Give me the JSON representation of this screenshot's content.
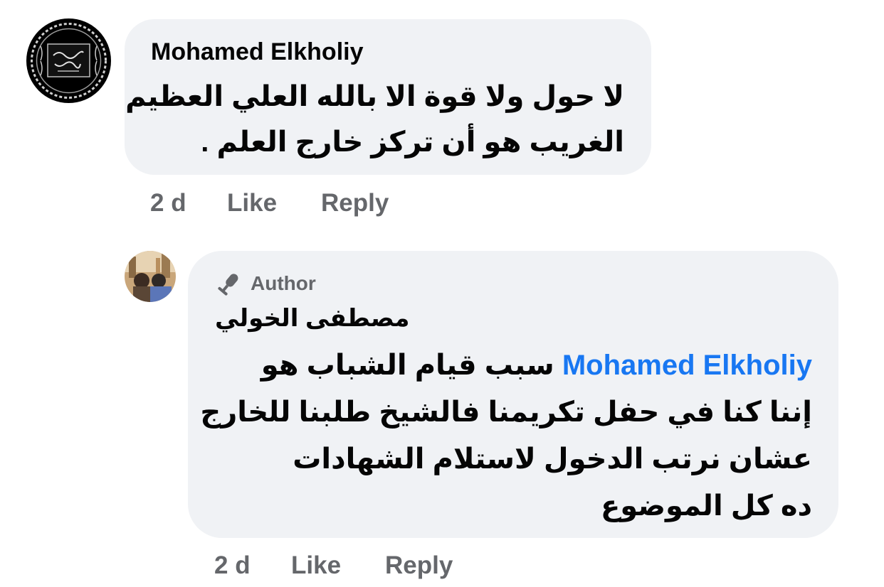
{
  "comment1": {
    "author": "Mohamed Elkholiy",
    "avatar_icon": "calligraphy-seal-avatar",
    "lines": [
      "لا حول ولا قوة الا بالله العلي العظيم",
      "الغريب هو أن تركز خارج العلم ."
    ],
    "time": "2 d",
    "like_label": "Like",
    "reply_label": "Reply"
  },
  "comment2": {
    "badge_icon": "microphone-icon",
    "badge_label": "Author",
    "author": "مصطفى الخولي",
    "avatar_icon": "mosque-photo-avatar",
    "mention": "Mohamed Elkholiy",
    "first_line_rest": "سبب قيام الشباب هو",
    "lines": [
      "إننا كنا في حفل تكريمنا فالشيخ طلبنا للخارج",
      "عشان نرتب الدخول لاستلام الشهادات",
      "ده كل الموضوع"
    ],
    "time": "2 d",
    "like_label": "Like",
    "reply_label": "Reply"
  },
  "colors": {
    "bubble": "#f0f2f5",
    "secondary_text": "#65676b",
    "mention": "#1877f2"
  }
}
